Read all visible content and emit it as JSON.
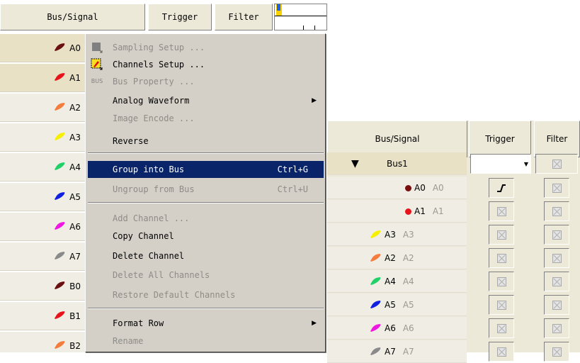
{
  "left_panel": {
    "headers": {
      "bus_signal": "Bus/Signal",
      "trigger": "Trigger",
      "filter": "Filter"
    },
    "channels": [
      {
        "name": "A0",
        "color": "#6b1010"
      },
      {
        "name": "A1",
        "color": "#e8141b"
      },
      {
        "name": "A2",
        "color": "#f47c3c"
      },
      {
        "name": "A3",
        "color": "#f6f000"
      },
      {
        "name": "A4",
        "color": "#22d06a"
      },
      {
        "name": "A5",
        "color": "#1020e0"
      },
      {
        "name": "A6",
        "color": "#f018e0"
      },
      {
        "name": "A7",
        "color": "#8a8a8a"
      },
      {
        "name": "B0",
        "color": "#6b1010"
      },
      {
        "name": "B1",
        "color": "#e8141b"
      },
      {
        "name": "B2",
        "color": "#f47c3c"
      }
    ]
  },
  "context_menu": {
    "items": [
      {
        "label": "Sampling Setup ...",
        "icon": "sampling-icon",
        "enabled": false
      },
      {
        "label": "Channels Setup ...",
        "icon": "channels-setup-icon",
        "enabled": true
      },
      {
        "label": "Bus Property ...",
        "icon": "bus-icon",
        "icon_text": "BUS",
        "enabled": false
      },
      {
        "label": "Analog Waveform",
        "enabled": true,
        "submenu": true
      },
      {
        "label": "Image Encode ...",
        "enabled": false
      },
      {
        "label": "Reverse",
        "enabled": true
      },
      {
        "label": "Group into Bus",
        "shortcut": "Ctrl+G",
        "enabled": true,
        "highlighted": true
      },
      {
        "label": "Ungroup from Bus",
        "shortcut": "Ctrl+U",
        "enabled": false
      },
      {
        "label": "Add Channel ...",
        "enabled": false
      },
      {
        "label": "Copy Channel",
        "enabled": true
      },
      {
        "label": "Delete Channel",
        "enabled": true
      },
      {
        "label": "Delete All Channels",
        "enabled": false
      },
      {
        "label": "Restore Default Channels",
        "enabled": false
      },
      {
        "label": "Format Row",
        "enabled": true,
        "submenu": true
      },
      {
        "label": "Rename",
        "enabled": false
      }
    ]
  },
  "right_panel": {
    "headers": {
      "bus_signal": "Bus/Signal",
      "trigger": "Trigger",
      "filter": "Filter"
    },
    "bus": {
      "name": "Bus1"
    },
    "rows": [
      {
        "name": "A0",
        "alias": "A0",
        "color": "#7a0e0e",
        "marker": "dot"
      },
      {
        "name": "A1",
        "alias": "A1",
        "color": "#e8141b",
        "marker": "dot"
      },
      {
        "name": "A3",
        "alias": "A3",
        "color": "#f6f000",
        "marker": "pen"
      },
      {
        "name": "A2",
        "alias": "A2",
        "color": "#f47c3c",
        "marker": "pen"
      },
      {
        "name": "A4",
        "alias": "A4",
        "color": "#22d06a",
        "marker": "pen"
      },
      {
        "name": "A5",
        "alias": "A5",
        "color": "#1020e0",
        "marker": "pen"
      },
      {
        "name": "A6",
        "alias": "A6",
        "color": "#f018e0",
        "marker": "pen"
      },
      {
        "name": "A7",
        "alias": "A7",
        "color": "#8a8a8a",
        "marker": "pen"
      }
    ]
  }
}
